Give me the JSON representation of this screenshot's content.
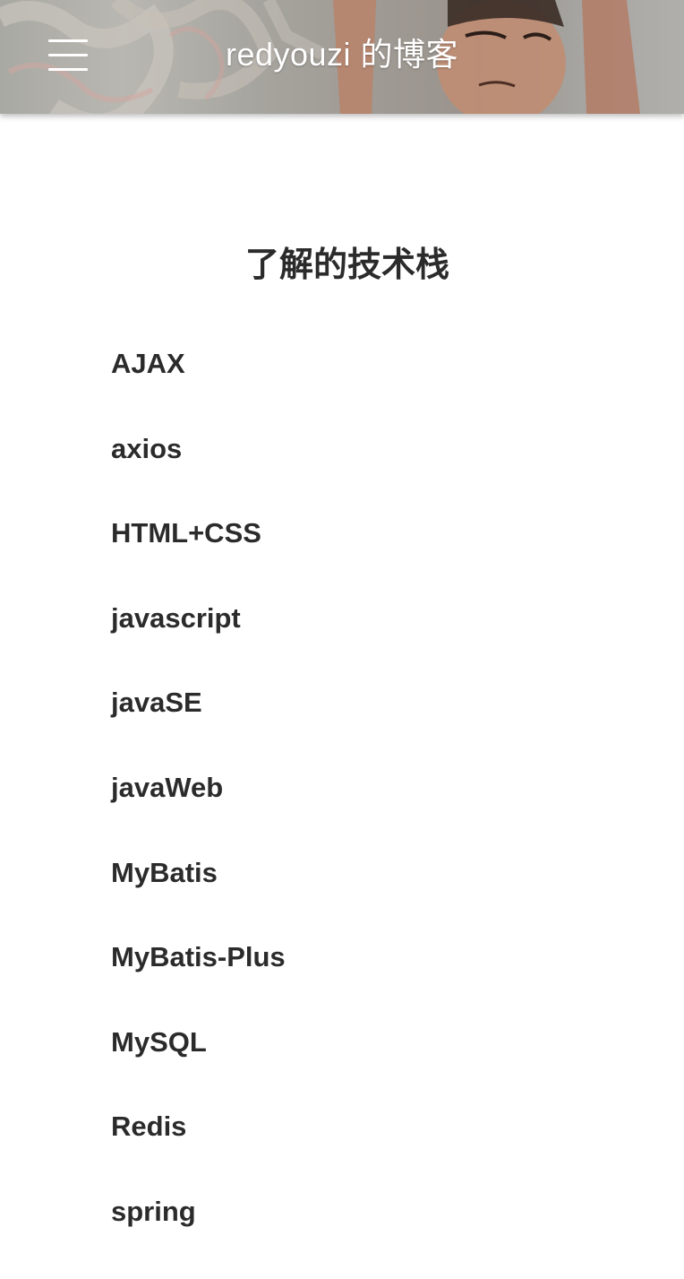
{
  "header": {
    "title": "redyouzi 的博客",
    "menu_icon": "hamburger-menu-icon"
  },
  "main": {
    "section_title": "了解的技术栈",
    "tech_items": [
      "AJAX",
      "axios",
      "HTML+CSS",
      "javascript",
      "javaSE",
      "javaWeb",
      "MyBatis",
      "MyBatis-Plus",
      "MySQL",
      "Redis",
      "spring"
    ]
  }
}
